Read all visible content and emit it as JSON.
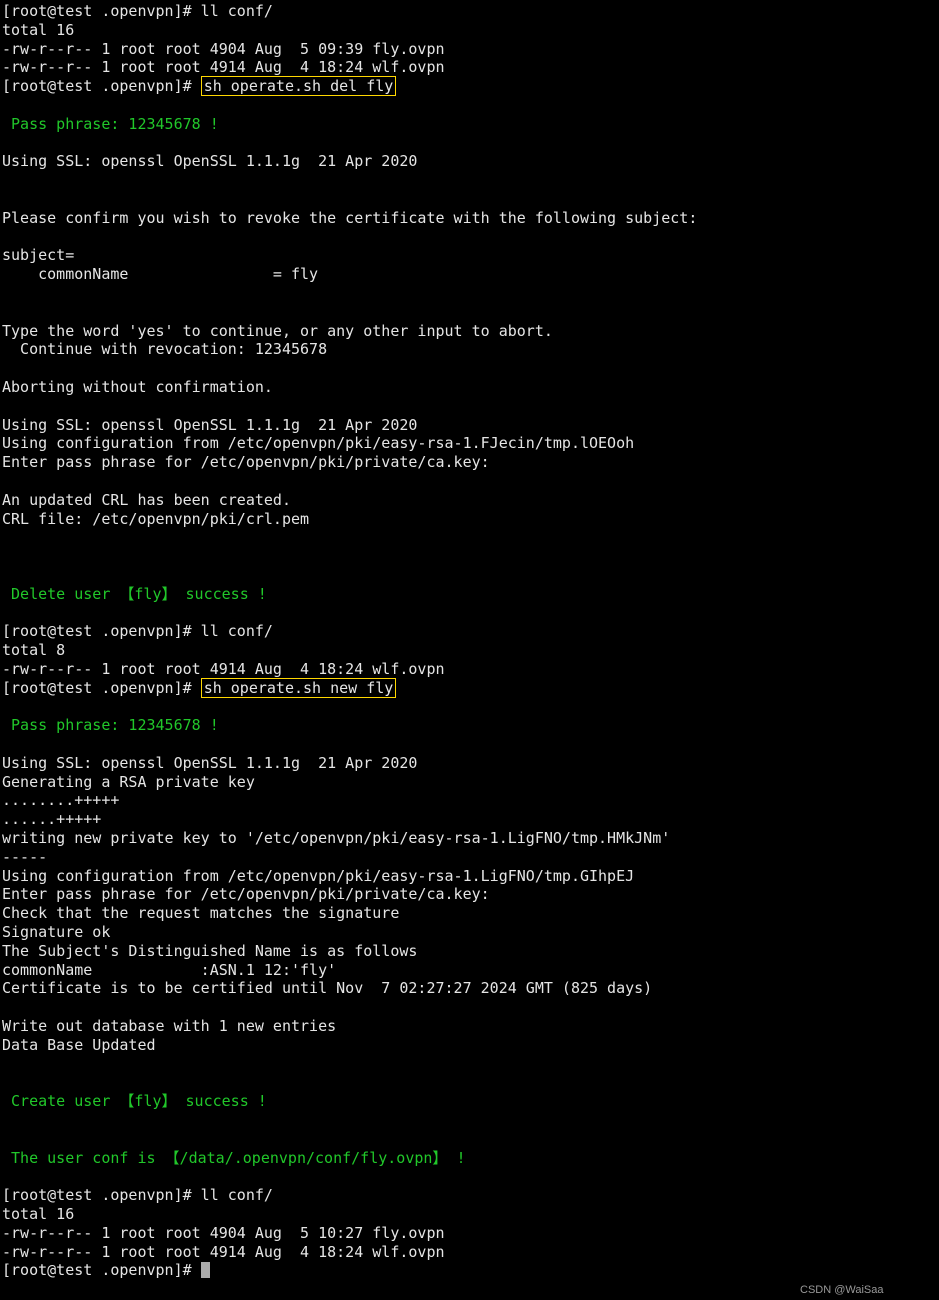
{
  "lines": [
    {
      "segments": [
        {
          "text": "[root@test .openvpn]# ll conf/"
        }
      ]
    },
    {
      "segments": [
        {
          "text": "total 16"
        }
      ]
    },
    {
      "segments": [
        {
          "text": "-rw-r--r-- 1 root root 4904 Aug  5 09:39 fly.ovpn"
        }
      ]
    },
    {
      "segments": [
        {
          "text": "-rw-r--r-- 1 root root 4914 Aug  4 18:24 wlf.ovpn"
        }
      ]
    },
    {
      "segments": [
        {
          "text": "[root@test .openvpn]# "
        },
        {
          "text": "sh operate.sh del fly",
          "box": true
        }
      ]
    },
    {
      "segments": [
        {
          "text": ""
        }
      ]
    },
    {
      "segments": [
        {
          "text": " Pass phrase: 12345678 ! ",
          "cls": "green"
        }
      ]
    },
    {
      "segments": [
        {
          "text": ""
        }
      ]
    },
    {
      "segments": [
        {
          "text": "Using SSL: openssl OpenSSL 1.1.1g  21 Apr 2020"
        }
      ]
    },
    {
      "segments": [
        {
          "text": ""
        }
      ]
    },
    {
      "segments": [
        {
          "text": ""
        }
      ]
    },
    {
      "segments": [
        {
          "text": "Please confirm you wish to revoke the certificate with the following subject:"
        }
      ]
    },
    {
      "segments": [
        {
          "text": ""
        }
      ]
    },
    {
      "segments": [
        {
          "text": "subject="
        }
      ]
    },
    {
      "segments": [
        {
          "text": "    commonName                = fly"
        }
      ]
    },
    {
      "segments": [
        {
          "text": ""
        }
      ]
    },
    {
      "segments": [
        {
          "text": ""
        }
      ]
    },
    {
      "segments": [
        {
          "text": "Type the word 'yes' to continue, or any other input to abort."
        }
      ]
    },
    {
      "segments": [
        {
          "text": "  Continue with revocation: 12345678"
        }
      ]
    },
    {
      "segments": [
        {
          "text": ""
        }
      ]
    },
    {
      "segments": [
        {
          "text": "Aborting without confirmation."
        }
      ]
    },
    {
      "segments": [
        {
          "text": ""
        }
      ]
    },
    {
      "segments": [
        {
          "text": "Using SSL: openssl OpenSSL 1.1.1g  21 Apr 2020"
        }
      ]
    },
    {
      "segments": [
        {
          "text": "Using configuration from /etc/openvpn/pki/easy-rsa-1.FJecin/tmp.lOEOoh"
        }
      ]
    },
    {
      "segments": [
        {
          "text": "Enter pass phrase for /etc/openvpn/pki/private/ca.key:"
        }
      ]
    },
    {
      "segments": [
        {
          "text": ""
        }
      ]
    },
    {
      "segments": [
        {
          "text": "An updated CRL has been created."
        }
      ]
    },
    {
      "segments": [
        {
          "text": "CRL file: /etc/openvpn/pki/crl.pem"
        }
      ]
    },
    {
      "segments": [
        {
          "text": ""
        }
      ]
    },
    {
      "segments": [
        {
          "text": ""
        }
      ]
    },
    {
      "segments": [
        {
          "text": ""
        }
      ]
    },
    {
      "segments": [
        {
          "text": " Delete user 【fly】 success ! ",
          "cls": "green"
        }
      ]
    },
    {
      "segments": [
        {
          "text": ""
        }
      ]
    },
    {
      "segments": [
        {
          "text": "[root@test .openvpn]# ll conf/"
        }
      ]
    },
    {
      "segments": [
        {
          "text": "total 8"
        }
      ]
    },
    {
      "segments": [
        {
          "text": "-rw-r--r-- 1 root root 4914 Aug  4 18:24 wlf.ovpn"
        }
      ]
    },
    {
      "segments": [
        {
          "text": "[root@test .openvpn]# "
        },
        {
          "text": "sh operate.sh new fly",
          "box": true
        }
      ]
    },
    {
      "segments": [
        {
          "text": ""
        }
      ]
    },
    {
      "segments": [
        {
          "text": " Pass phrase: 12345678 ! ",
          "cls": "green"
        }
      ]
    },
    {
      "segments": [
        {
          "text": ""
        }
      ]
    },
    {
      "segments": [
        {
          "text": "Using SSL: openssl OpenSSL 1.1.1g  21 Apr 2020"
        }
      ]
    },
    {
      "segments": [
        {
          "text": "Generating a RSA private key"
        }
      ]
    },
    {
      "segments": [
        {
          "text": "........+++++"
        }
      ]
    },
    {
      "segments": [
        {
          "text": "......+++++"
        }
      ]
    },
    {
      "segments": [
        {
          "text": "writing new private key to '/etc/openvpn/pki/easy-rsa-1.LigFNO/tmp.HMkJNm'"
        }
      ]
    },
    {
      "segments": [
        {
          "text": "-----"
        }
      ]
    },
    {
      "segments": [
        {
          "text": "Using configuration from /etc/openvpn/pki/easy-rsa-1.LigFNO/tmp.GIhpEJ"
        }
      ]
    },
    {
      "segments": [
        {
          "text": "Enter pass phrase for /etc/openvpn/pki/private/ca.key:"
        }
      ]
    },
    {
      "segments": [
        {
          "text": "Check that the request matches the signature"
        }
      ]
    },
    {
      "segments": [
        {
          "text": "Signature ok"
        }
      ]
    },
    {
      "segments": [
        {
          "text": "The Subject's Distinguished Name is as follows"
        }
      ]
    },
    {
      "segments": [
        {
          "text": "commonName            :ASN.1 12:'fly'"
        }
      ]
    },
    {
      "segments": [
        {
          "text": "Certificate is to be certified until Nov  7 02:27:27 2024 GMT (825 days)"
        }
      ]
    },
    {
      "segments": [
        {
          "text": ""
        }
      ]
    },
    {
      "segments": [
        {
          "text": "Write out database with 1 new entries"
        }
      ]
    },
    {
      "segments": [
        {
          "text": "Data Base Updated"
        }
      ]
    },
    {
      "segments": [
        {
          "text": ""
        }
      ]
    },
    {
      "segments": [
        {
          "text": ""
        }
      ]
    },
    {
      "segments": [
        {
          "text": " Create user 【fly】 success ! ",
          "cls": "green"
        }
      ]
    },
    {
      "segments": [
        {
          "text": ""
        }
      ]
    },
    {
      "segments": [
        {
          "text": ""
        }
      ]
    },
    {
      "segments": [
        {
          "text": " The user conf is 【/data/.openvpn/conf/fly.ovpn】 ! ",
          "cls": "green"
        }
      ]
    },
    {
      "segments": [
        {
          "text": ""
        }
      ]
    },
    {
      "segments": [
        {
          "text": "[root@test .openvpn]# ll conf/"
        }
      ]
    },
    {
      "segments": [
        {
          "text": "total 16"
        }
      ]
    },
    {
      "segments": [
        {
          "text": "-rw-r--r-- 1 root root 4904 Aug  5 10:27 fly.ovpn"
        }
      ]
    },
    {
      "segments": [
        {
          "text": "-rw-r--r-- 1 root root 4914 Aug  4 18:24 wlf.ovpn"
        }
      ]
    },
    {
      "segments": [
        {
          "text": "[root@test .openvpn]# "
        }
      ],
      "cursor": true
    }
  ],
  "watermark": "CSDN @WaiSaa"
}
